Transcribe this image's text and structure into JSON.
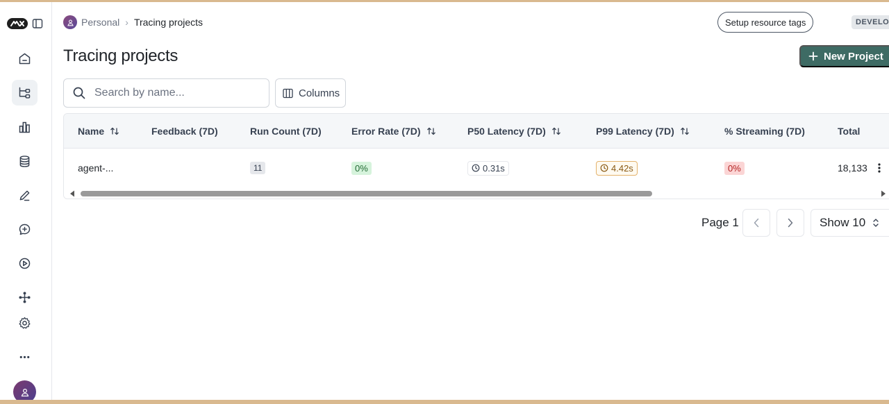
{
  "breadcrumb": {
    "personal": "Personal",
    "separator": "›",
    "current": "Tracing projects"
  },
  "header": {
    "setup_tags_label": "Setup resource tags",
    "env_badge": "DEVELOPER"
  },
  "page": {
    "title": "Tracing projects",
    "new_project_label": "New Project"
  },
  "search": {
    "placeholder": "Search by name...",
    "value": ""
  },
  "columns_button": "Columns",
  "table": {
    "headers": {
      "name": "Name",
      "feedback": "Feedback (7D)",
      "run_count": "Run Count (7D)",
      "error_rate": "Error Rate (7D)",
      "p50": "P50 Latency (7D)",
      "p99": "P99 Latency (7D)",
      "streaming": "% Streaming (7D)",
      "total": "Total"
    },
    "rows": [
      {
        "name": "agent-...",
        "feedback": "",
        "run_count": "11",
        "error_rate": "0%",
        "p50": "0.31s",
        "p99": "4.42s",
        "streaming": "0%",
        "total": "18,133"
      }
    ]
  },
  "pagination": {
    "page_label": "Page 1",
    "show_label": "Show 10"
  },
  "icons": {
    "sidebar": [
      "home-icon",
      "tracing-icon",
      "dashboard-icon",
      "datasets-icon",
      "annotation-icon",
      "prompt-icon",
      "playground-icon",
      "deployments-icon",
      "settings-icon",
      "more-icon"
    ]
  },
  "colors": {
    "primary": "#3e6b64",
    "success_bg": "#d6f3dc",
    "error_bg": "#fbd5d5",
    "warning_border": "#e3b26b"
  }
}
